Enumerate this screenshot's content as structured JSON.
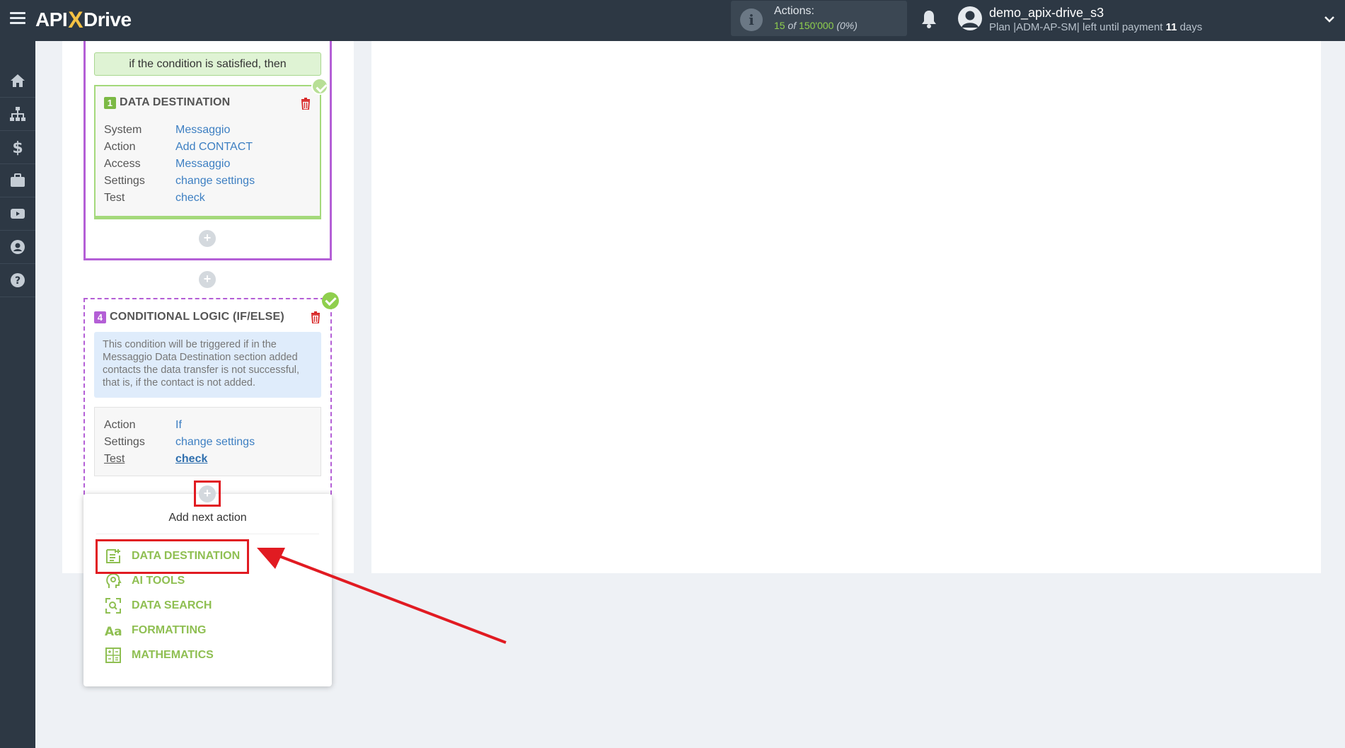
{
  "header": {
    "logo_api": "API",
    "logo_x": "X",
    "logo_drive": "Drive",
    "actions_title": "Actions:",
    "actions_used": "15",
    "actions_of": "of",
    "actions_total": "150'000",
    "actions_pct": "(0%)",
    "user_name": "demo_apix-drive_s3",
    "plan_text": "Plan |ADM-AP-SM| left until payment",
    "plan_days": "11",
    "plan_days_label": "days"
  },
  "sidebar": {
    "items": [
      "home-icon",
      "sitemap-icon",
      "dollar-icon",
      "briefcase-icon",
      "video-icon",
      "user-circle-icon",
      "help-icon"
    ]
  },
  "condition_banner": "if the condition is satisfied, then",
  "dest_card": {
    "number": "1",
    "title": "DATA DESTINATION",
    "rows": [
      {
        "key": "System",
        "value": "Messaggio"
      },
      {
        "key": "Action",
        "value": "Add CONTACT"
      },
      {
        "key": "Access",
        "value": "Messaggio"
      },
      {
        "key": "Settings",
        "value": "change settings"
      },
      {
        "key": "Test",
        "value": "check"
      }
    ]
  },
  "logic_card": {
    "number": "4",
    "title": "CONDITIONAL LOGIC (IF/ELSE)",
    "note": "This condition will be triggered if in the Messaggio Data Destination section added contacts the data transfer is not successful, that is, if the contact is not added.",
    "rows": [
      {
        "key": "Action",
        "value": "If"
      },
      {
        "key": "Settings",
        "value": "change settings"
      },
      {
        "key": "Test",
        "value": "check"
      }
    ]
  },
  "plus_symbol": "+",
  "dropdown": {
    "title": "Add next action",
    "items": [
      {
        "label": "DATA DESTINATION",
        "icon": "document-add-icon"
      },
      {
        "label": "AI TOOLS",
        "icon": "ai-head-icon"
      },
      {
        "label": "DATA SEARCH",
        "icon": "search-frame-icon"
      },
      {
        "label": "FORMATTING",
        "icon": "text-aa-icon"
      },
      {
        "label": "MATHEMATICS",
        "icon": "calculator-icon"
      }
    ]
  },
  "colors": {
    "topbar": "#2d3844",
    "accent_green": "#8fcf4d",
    "link_blue": "#3d7fc2",
    "purple_frame": "#b45fd6",
    "highlight_red": "#e11b22"
  }
}
